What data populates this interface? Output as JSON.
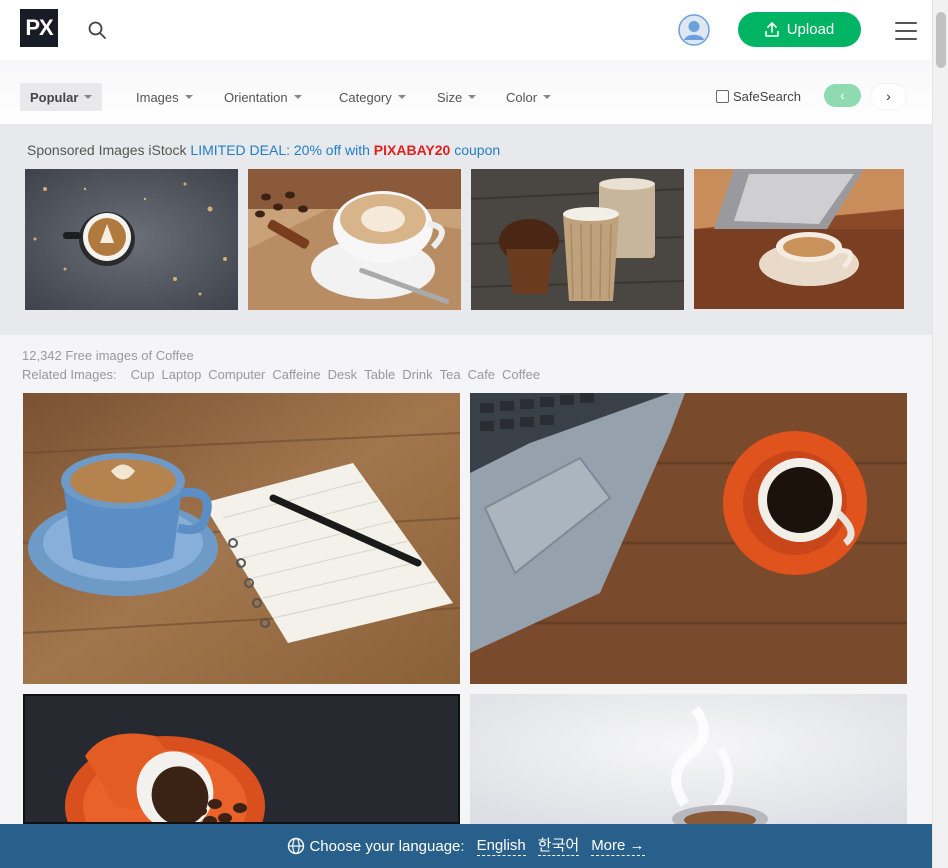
{
  "header": {
    "logo_text": "PX",
    "upload_label": "Upload",
    "brand_color": "#00b464"
  },
  "filters": {
    "popular": "Popular",
    "images": "Images",
    "orientation": "Orientation",
    "category": "Category",
    "size": "Size",
    "color": "Color",
    "safesearch_label": "SafeSearch",
    "safesearch_checked": false,
    "prev_label": "‹",
    "next_label": "›"
  },
  "sponsored": {
    "prefix": "Sponsored Images iStock",
    "deal_text": "LIMITED DEAL: 20% off with",
    "code": "PIXABAY20",
    "suffix": "coupon",
    "thumbnails": [
      "latte-art-tree",
      "latte-coffee-beans",
      "paper-cups-muffin",
      "cup-by-laptop"
    ]
  },
  "results": {
    "count_text": "12,342 Free images of Coffee",
    "related_label": "Related Images:",
    "related_tags": [
      "Cup",
      "Laptop",
      "Computer",
      "Caffeine",
      "Desk",
      "Table",
      "Drink",
      "Tea",
      "Cafe",
      "Coffee"
    ],
    "images": [
      "blue-cup-notebook",
      "laptop-orange-cup",
      "spilled-coffee-beans",
      "steaming-cup"
    ]
  },
  "language_bar": {
    "label": "Choose your language:",
    "english": "English",
    "korean": "한국어",
    "more": "More →",
    "background": "#28608b"
  }
}
